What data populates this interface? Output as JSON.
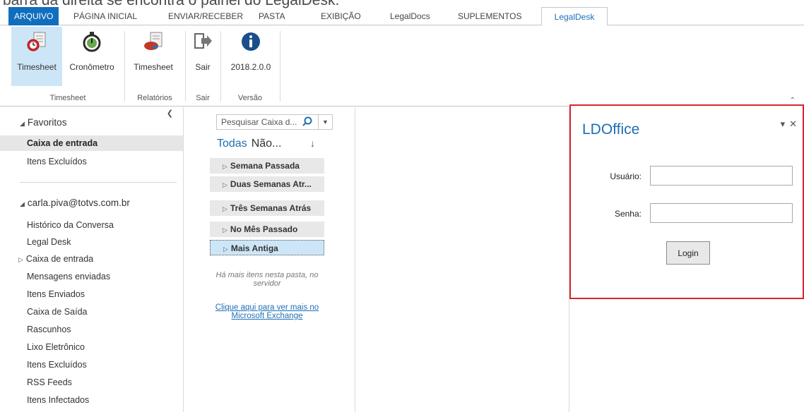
{
  "caption": "barra da direita se encontra o painel do LegalDesk.",
  "tabs": [
    {
      "label": "ARQUIVO"
    },
    {
      "label": "PÁGINA INICIAL"
    },
    {
      "label": "ENVIAR/RECEBER"
    },
    {
      "label": "PASTA"
    },
    {
      "label": "EXIBIÇÃO"
    },
    {
      "label": "LegalDocs"
    },
    {
      "label": "SUPLEMENTOS"
    },
    {
      "label": "LegalDesk"
    }
  ],
  "ribbon": {
    "buttons": [
      {
        "label": "Timesheet",
        "icon": "timesheet-clock-icon"
      },
      {
        "label": "Cronômetro",
        "icon": "stopwatch-icon"
      },
      {
        "label": "Timesheet",
        "icon": "report-chart-icon"
      },
      {
        "label": "Sair",
        "icon": "exit-arrow-icon"
      },
      {
        "label": "2018.2.0.0",
        "icon": "info-icon"
      }
    ],
    "groups": [
      {
        "label": "Timesheet"
      },
      {
        "label": "Relatórios"
      },
      {
        "label": "Sair"
      },
      {
        "label": "Versão"
      }
    ],
    "colors": {
      "accent": "#106ebe",
      "selected": "#cde6f7"
    }
  },
  "folders": {
    "favorites_header": "Favoritos",
    "favorites": [
      {
        "label": "Caixa de entrada"
      },
      {
        "label": "Itens Excluídos"
      }
    ],
    "account_header": "carla.piva@totvs.com.br",
    "items": [
      {
        "label": "Histórico da Conversa"
      },
      {
        "label": "Legal Desk"
      },
      {
        "label": "Caixa de entrada"
      },
      {
        "label": "Mensagens enviadas"
      },
      {
        "label": "Itens Enviados"
      },
      {
        "label": "Caixa de Saída"
      },
      {
        "label": "Rascunhos"
      },
      {
        "label": "Lixo Eletrônico"
      },
      {
        "label": "Itens Excluídos"
      },
      {
        "label": "RSS Feeds"
      },
      {
        "label": "Itens Infectados"
      }
    ]
  },
  "messages": {
    "search_placeholder": "Pesquisar Caixa d...",
    "filter_all": "Todas",
    "filter_unread": "Não...",
    "groups": [
      {
        "label": "Semana Passada"
      },
      {
        "label": "Duas Semanas Atr..."
      },
      {
        "label": "Três Semanas Atrás"
      },
      {
        "label": "No Mês Passado"
      },
      {
        "label": "Mais Antiga"
      }
    ],
    "more_note": "Há mais itens nesta pasta, no servidor",
    "exchange_link": "Clique aqui para ver mais no Microsoft Exchange"
  },
  "panel": {
    "title": "LDOffice",
    "user_label": "Usuário:",
    "user_value": "",
    "password_label": "Senha:",
    "password_value": "",
    "login_label": "Login",
    "border_color": "#d9262c"
  }
}
